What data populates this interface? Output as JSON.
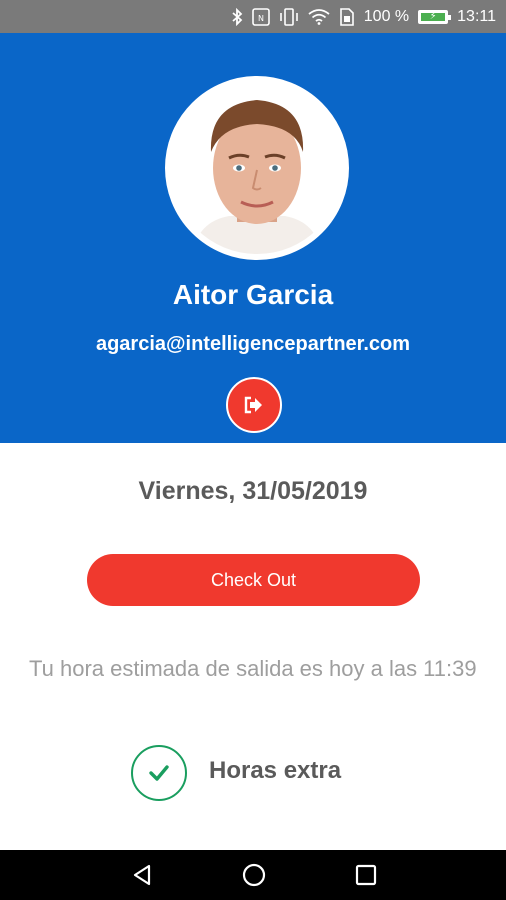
{
  "status_bar": {
    "icons": [
      "bluetooth-icon",
      "nfc-icon",
      "vibrate-icon",
      "wifi-icon",
      "sim-icon",
      "battery-icon"
    ],
    "battery_percent": "100 %",
    "battery_level": 1.0,
    "time": "13:11"
  },
  "profile": {
    "name": "Aitor Garcia",
    "email": "agarcia@intelligencepartner.com",
    "logout_icon": "logout-icon"
  },
  "main": {
    "date": "Viernes, 31/05/2019",
    "checkout_label": "Check Out",
    "estimate_text": "Tu hora estimada de salida es hoy a las 11:39",
    "extra_hours_label": "Horas extra",
    "extra_hours_checked": true
  },
  "nav_bar": {
    "icons": [
      "back-icon",
      "home-icon",
      "recents-icon"
    ]
  },
  "colors": {
    "header_blue": "#0a66c8",
    "accent_red": "#f0392e",
    "check_green": "#1a9e5f",
    "text_gray": "#5a5a5a",
    "muted_gray": "#9e9e9e"
  }
}
